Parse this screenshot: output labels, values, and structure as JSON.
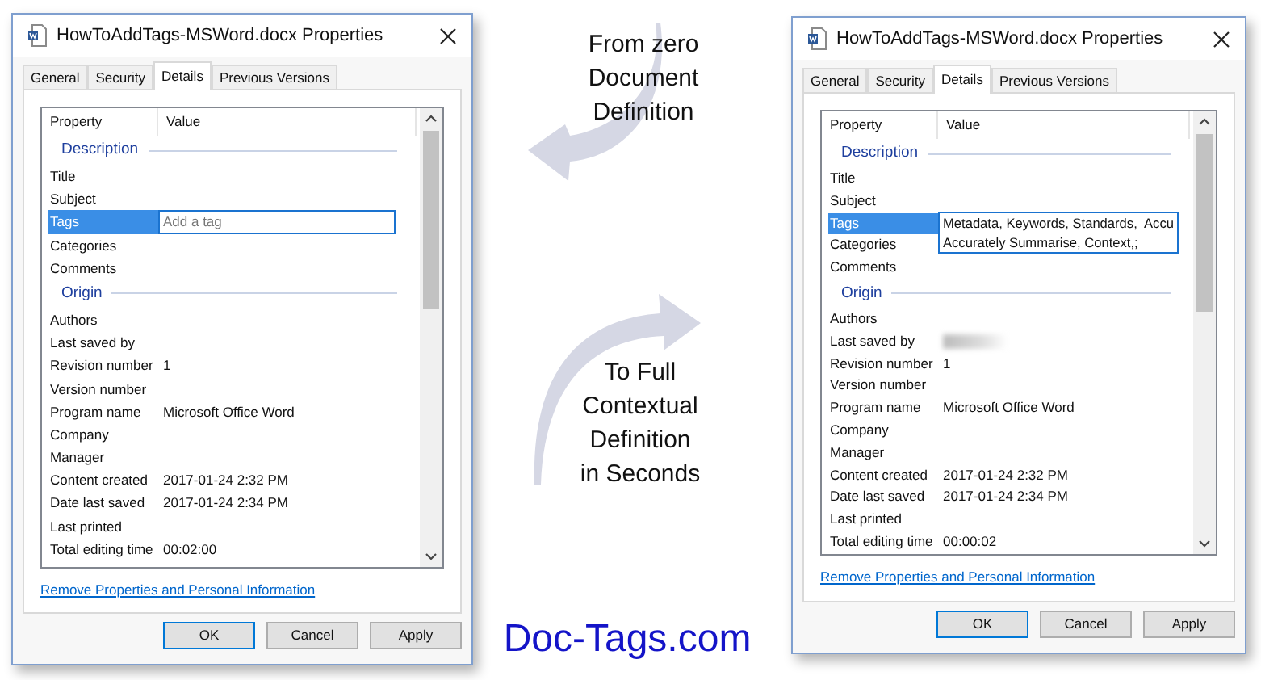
{
  "dialogs": [
    {
      "title": "HowToAddTags-MSWord.docx Properties",
      "tabs": [
        {
          "label": "General",
          "selected": false
        },
        {
          "label": "Security",
          "selected": false
        },
        {
          "label": "Details",
          "selected": true
        },
        {
          "label": "Previous Versions",
          "selected": false
        }
      ],
      "columns": [
        "Property",
        "Value"
      ],
      "sections": [
        {
          "heading": "Description",
          "rows": [
            {
              "kind": "text",
              "label": "Title",
              "selected": false
            },
            {
              "kind": "text",
              "label": "Subject",
              "selected": false
            },
            {
              "kind": "field",
              "label": "Tags",
              "selected": true,
              "placeholder": "Add a tag"
            },
            {
              "kind": "text",
              "label": "Categories",
              "selected": false
            },
            {
              "kind": "text",
              "label": "Comments",
              "selected": false
            }
          ]
        },
        {
          "heading": "Origin",
          "rows": [
            {
              "kind": "text",
              "label": "Authors",
              "selected": false
            },
            {
              "kind": "text",
              "label": "Last saved by",
              "selected": false
            },
            {
              "kind": "text",
              "label": "Revision number",
              "value": "1",
              "selected": false
            },
            {
              "kind": "text",
              "label": "Version number",
              "selected": false
            },
            {
              "kind": "text",
              "label": "Program name",
              "value": "Microsoft Office Word",
              "selected": false
            },
            {
              "kind": "text",
              "label": "Company",
              "selected": false
            },
            {
              "kind": "text",
              "label": "Manager",
              "selected": false
            },
            {
              "kind": "text",
              "label": "Content created",
              "value": "2017-01-24 2:32 PM",
              "selected": false
            },
            {
              "kind": "text",
              "label": "Date last saved",
              "value": "2017-01-24 2:34 PM",
              "selected": false
            },
            {
              "kind": "text",
              "label": "Last printed",
              "selected": false
            },
            {
              "kind": "text",
              "label": "Total editing time",
              "value": "00:02:00",
              "selected": false
            }
          ]
        }
      ],
      "link": "Remove Properties and Personal Information",
      "buttons": [
        {
          "label": "OK",
          "default": true
        },
        {
          "label": "Cancel",
          "default": false
        },
        {
          "label": "Apply",
          "default": false
        }
      ]
    },
    {
      "title": "HowToAddTags-MSWord.docx Properties",
      "tabs": [
        {
          "label": "General",
          "selected": false
        },
        {
          "label": "Security",
          "selected": false
        },
        {
          "label": "Details",
          "selected": true
        },
        {
          "label": "Previous Versions",
          "selected": false
        }
      ],
      "columns": [
        "Property",
        "Value"
      ],
      "sections": [
        {
          "heading": "Description",
          "rows": [
            {
              "kind": "text",
              "label": "Title",
              "selected": false
            },
            {
              "kind": "text",
              "label": "Subject",
              "selected": false
            },
            {
              "kind": "field",
              "label": "Tags",
              "selected": true,
              "value_lines": [
                "Metadata, Keywords, Standards,  Accu",
                "Accurately Summarise, Context,;"
              ]
            },
            {
              "kind": "text",
              "label": "Categories",
              "selected": false
            },
            {
              "kind": "text",
              "label": "Comments",
              "selected": false
            }
          ]
        },
        {
          "heading": "Origin",
          "rows": [
            {
              "kind": "text",
              "label": "Authors",
              "selected": false
            },
            {
              "kind": "blurred",
              "label": "Last saved by",
              "selected": false
            },
            {
              "kind": "text",
              "label": "Revision number",
              "value": "1",
              "selected": false
            },
            {
              "kind": "text",
              "label": "Version number",
              "selected": false
            },
            {
              "kind": "text",
              "label": "Program name",
              "value": "Microsoft Office Word",
              "selected": false
            },
            {
              "kind": "text",
              "label": "Company",
              "selected": false
            },
            {
              "kind": "text",
              "label": "Manager",
              "selected": false
            },
            {
              "kind": "text",
              "label": "Content created",
              "value": "2017-01-24 2:32 PM",
              "selected": false
            },
            {
              "kind": "text",
              "label": "Date last saved",
              "value": "2017-01-24 2:34 PM",
              "selected": false
            },
            {
              "kind": "text",
              "label": "Last printed",
              "selected": false
            },
            {
              "kind": "text",
              "label": "Total editing time",
              "value": "00:00:02",
              "selected": false
            }
          ]
        }
      ],
      "link": "Remove Properties and Personal Information",
      "buttons": [
        {
          "label": "OK",
          "default": true
        },
        {
          "label": "Cancel",
          "default": false
        },
        {
          "label": "Apply",
          "default": false
        }
      ]
    }
  ],
  "middle": {
    "captions": [
      {
        "lines": [
          "From zero",
          "Document",
          "Definition"
        ]
      },
      {
        "lines": [
          "To Full",
          "Contextual",
          "Definition",
          "in Seconds"
        ]
      }
    ],
    "site": "Doc-Tags.com"
  }
}
